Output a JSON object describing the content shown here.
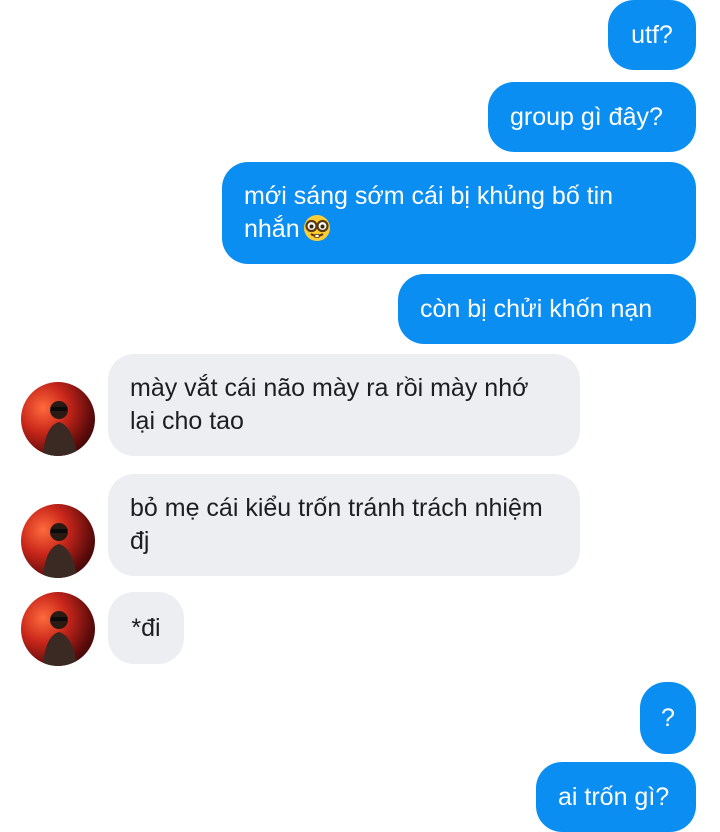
{
  "messages": [
    {
      "id": "m1",
      "side": "out",
      "text": "utf?"
    },
    {
      "id": "m2",
      "side": "out",
      "text": "group gì đây?"
    },
    {
      "id": "m3",
      "side": "out",
      "text": "mới sáng sớm cái bị khủng bố tin nhắn",
      "emoji": "nerd-face-icon"
    },
    {
      "id": "m4",
      "side": "out",
      "text": "còn bị chửi khốn nạn"
    },
    {
      "id": "m5",
      "side": "in",
      "text": "mày vắt cái não mày ra rồi mày nhớ lại cho tao"
    },
    {
      "id": "m6",
      "side": "in",
      "text": "bỏ mẹ cái kiểu trốn tránh trách nhiệm đj"
    },
    {
      "id": "m7",
      "side": "in",
      "text": "*đi"
    },
    {
      "id": "m8",
      "side": "out",
      "text": "?"
    },
    {
      "id": "m9",
      "side": "out",
      "text": "ai trốn gì?"
    }
  ],
  "colors": {
    "outgoing_bubble": "#0b8ef2",
    "incoming_bubble": "#edeef2",
    "outgoing_text": "#ffffff",
    "incoming_text": "#1c1e21"
  }
}
